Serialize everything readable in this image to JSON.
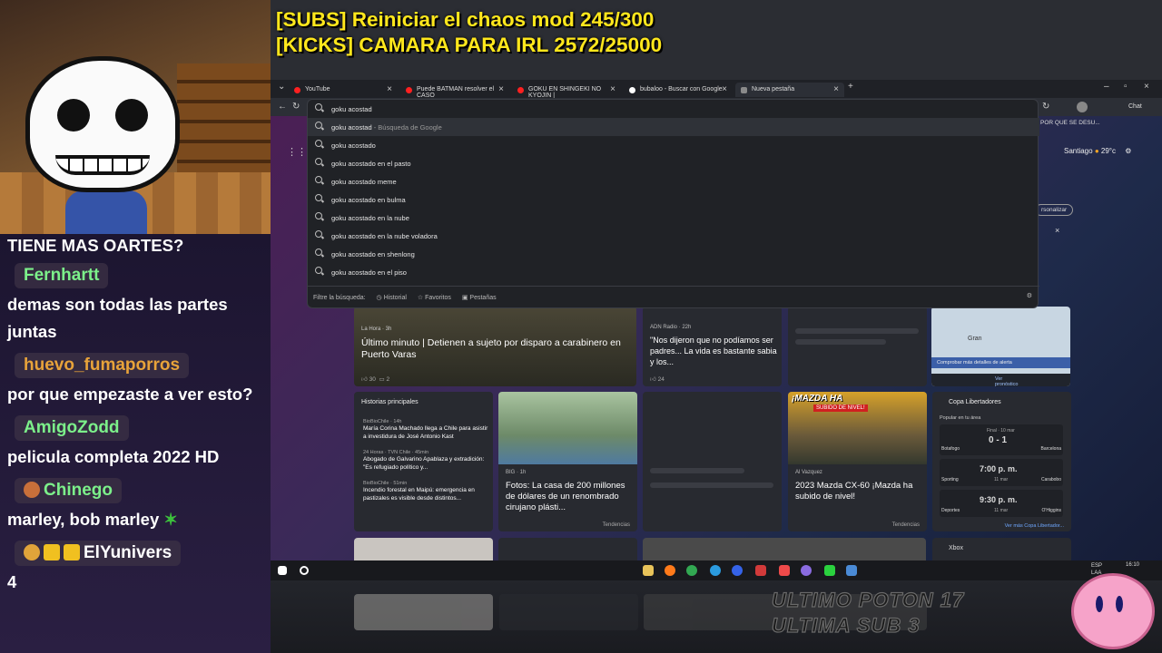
{
  "goals": {
    "line1": "[SUBS] Reiniciar el chaos mod 245/300",
    "line2": "[KICKS] CAMARA PARA IRL 2572/25000"
  },
  "chat": {
    "top_text": "TIENE MAS OARTES?",
    "messages": [
      {
        "user": "Fernhartt",
        "user_color": "#7cf08a",
        "text": "demas son todas las partes juntas"
      },
      {
        "user": "huevo_fumaporros",
        "user_color": "#e8a33a",
        "text": "por que empezaste a ver esto?"
      },
      {
        "user": "AmigoZodd",
        "user_color": "#7cf08a",
        "text": "pelicula completa 2022 HD"
      },
      {
        "user": "Chinego",
        "user_color": "#7cf08a",
        "text": "marley, bob marley"
      },
      {
        "user": "ElYunivers",
        "user_color": "#ffffff",
        "text": "4"
      }
    ]
  },
  "browser": {
    "tabs": [
      {
        "label": "YouTube",
        "color": "#ff2020"
      },
      {
        "label": "Puede BATMAN resolver el CASO",
        "color": "#ff2020"
      },
      {
        "label": "GOKU EN SHINGEKI NO KYOJIN |",
        "color": "#ff2020"
      },
      {
        "label": "bubaloo - Buscar con Google",
        "color": "#ffffff"
      },
      {
        "label": "Nueva pestaña",
        "color": "#8a8a8a"
      }
    ],
    "address_value": "goku acostad",
    "suggestions": [
      {
        "text": "goku acostad",
        "hint": " - Búsqueda de Google"
      },
      {
        "text": "goku acostado",
        "hint": ""
      },
      {
        "text": "goku acostado en el pasto",
        "hint": ""
      },
      {
        "text": "goku acostado meme",
        "hint": ""
      },
      {
        "text": "goku acostado en bulma",
        "hint": ""
      },
      {
        "text": "goku acostado en la nube",
        "hint": ""
      },
      {
        "text": "goku acostado en la nube voladora",
        "hint": ""
      },
      {
        "text": "goku acostado en shenlong",
        "hint": ""
      },
      {
        "text": "goku acostado en el piso",
        "hint": ""
      }
    ],
    "filter_label": "Filtre la búsqueda:",
    "filters": [
      "Historial",
      "Favoritos",
      "Pestañas"
    ],
    "chat_label": "Chat",
    "bookmark": "POR QUE SE DESU...",
    "weather": {
      "city": "Santiago",
      "temp": "29°c"
    },
    "personalize": "rsonalizar"
  },
  "news": {
    "hero": {
      "source": "La Hora · 3h",
      "title": "Último minuto | Detienen a sujeto por disparo a carabinero en Puerto Varas",
      "likes": "30",
      "comments": "2"
    },
    "adn": {
      "source": "ADN Radio · 22h",
      "title": "\"Nos dijeron que no podíamos ser padres... La vida es bastante sabia y los...",
      "likes": "24"
    },
    "map": {
      "city": "Gran",
      "link1": "Comprobar más detalles de alerta",
      "link2": "Ver pronóstico completo"
    },
    "historias": {
      "header": "Historias principales",
      "items": [
        {
          "source": "BioBioChile · 14h",
          "text": "María Corina Machado llega a Chile para asistir a investidura de José Antonio Kast"
        },
        {
          "source": "24 Horas · TVN Chile · 45min",
          "text": "Abogado de Galvarino Apablaza y extradición: \"Es refugiado político y..."
        },
        {
          "source": "BioBioChile · 51min",
          "text": "Incendio forestal en Maipú: emergencia en pastizales es visible desde distintos..."
        }
      ]
    },
    "big": {
      "source": "BIG · 1h",
      "title": "Fotos: La casa de 200 millones de dólares de un renombrado cirujano plásti...",
      "trend": "Tendencias"
    },
    "mazda": {
      "banner": "¡MAZDA HA",
      "sub": "SUBIDO DE NIVEL!",
      "source": "Al Vazquez",
      "title": "2023 Mazda CX-60 ¡Mazda ha subido de nivel!",
      "trend": "Tendencias"
    },
    "libertadores": {
      "header": "Copa Libertadores",
      "popular": "Popular en tu área",
      "matches": [
        {
          "home": "Botafogo",
          "away": "Barcelona",
          "score": "0 - 1",
          "status": "Final · 10 mar"
        },
        {
          "home": "Sporting",
          "away": "Carabobo",
          "score": "7:00 p. m.",
          "status": "11 mar"
        },
        {
          "home": "Deportes",
          "away": "O'Higgins",
          "score": "9:30 p. m.",
          "status": "11 mar"
        }
      ],
      "more": "Ver más Copa Libertador..."
    },
    "xbox": "Xbox"
  },
  "taskbar": {
    "lang": "ESP LAA",
    "time": "16:10"
  },
  "overlay_bottom": {
    "line1": "ULTIMO POTON",
    "num1": "17",
    "line2": "ULTIMA SUB",
    "num2": "3"
  }
}
